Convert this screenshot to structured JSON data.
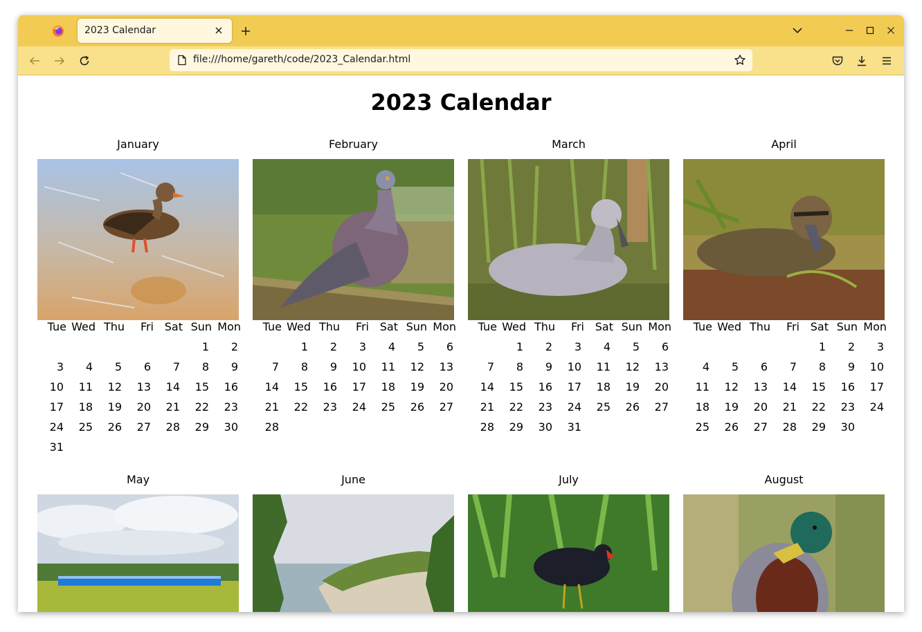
{
  "browser": {
    "tab_title": "2023 Calendar",
    "url": "file:///home/gareth/code/2023_Calendar.html",
    "icons": [
      "firefox-icon",
      "close-icon",
      "plus-icon",
      "chevron-down-icon",
      "minimize-icon",
      "maximize-icon",
      "window-close-icon",
      "back-arrow-icon",
      "forward-arrow-icon",
      "reload-icon",
      "page-icon",
      "star-icon",
      "pocket-icon",
      "download-icon",
      "menu-icon"
    ],
    "colors": {
      "tabbar": "#f2cb52",
      "navbar": "#f9e08a",
      "urlbar": "#fff8df"
    }
  },
  "page": {
    "title": "2023 Calendar",
    "weekdays": [
      "Tue",
      "Wed",
      "Thu",
      "Fri",
      "Sat",
      "Sun",
      "Mon"
    ],
    "months": [
      {
        "name": "January",
        "photo": "mallard-duck-on-ice",
        "rows": [
          [
            "",
            "",
            "",
            "",
            "",
            "1",
            "2"
          ],
          [
            "3",
            "4",
            "5",
            "6",
            "7",
            "8",
            "9"
          ],
          [
            "10",
            "11",
            "12",
            "13",
            "14",
            "15",
            "16"
          ],
          [
            "17",
            "18",
            "19",
            "20",
            "21",
            "22",
            "23"
          ],
          [
            "24",
            "25",
            "26",
            "27",
            "28",
            "29",
            "30"
          ],
          [
            "31",
            "",
            "",
            "",
            "",
            "",
            ""
          ]
        ]
      },
      {
        "name": "February",
        "photo": "wood-pigeon-on-fence",
        "rows": [
          [
            "",
            "1",
            "2",
            "3",
            "4",
            "5",
            "6"
          ],
          [
            "7",
            "8",
            "9",
            "10",
            "11",
            "12",
            "13"
          ],
          [
            "14",
            "15",
            "16",
            "17",
            "18",
            "19",
            "20"
          ],
          [
            "21",
            "22",
            "23",
            "24",
            "25",
            "26",
            "27"
          ],
          [
            "28",
            "",
            "",
            "",
            "",
            "",
            ""
          ]
        ]
      },
      {
        "name": "March",
        "photo": "cygnet-in-grass",
        "rows": [
          [
            "",
            "1",
            "2",
            "3",
            "4",
            "5",
            "6"
          ],
          [
            "7",
            "8",
            "9",
            "10",
            "11",
            "12",
            "13"
          ],
          [
            "14",
            "15",
            "16",
            "17",
            "18",
            "19",
            "20"
          ],
          [
            "21",
            "22",
            "23",
            "24",
            "25",
            "26",
            "27"
          ],
          [
            "28",
            "29",
            "30",
            "31",
            "",
            "",
            ""
          ]
        ]
      },
      {
        "name": "April",
        "photo": "duckling-resting",
        "rows": [
          [
            "",
            "",
            "",
            "",
            "1",
            "2",
            "3"
          ],
          [
            "4",
            "5",
            "6",
            "7",
            "8",
            "9",
            "10"
          ],
          [
            "11",
            "12",
            "13",
            "14",
            "15",
            "16",
            "17"
          ],
          [
            "18",
            "19",
            "20",
            "21",
            "22",
            "23",
            "24"
          ],
          [
            "25",
            "26",
            "27",
            "28",
            "29",
            "30",
            ""
          ]
        ]
      },
      {
        "name": "May",
        "photo": "blue-train-in-countryside",
        "rows": []
      },
      {
        "name": "June",
        "photo": "coastal-cliffs-and-beach",
        "rows": []
      },
      {
        "name": "July",
        "photo": "moorhen-in-reeds",
        "rows": []
      },
      {
        "name": "August",
        "photo": "mallard-drake-portrait",
        "rows": []
      }
    ]
  }
}
